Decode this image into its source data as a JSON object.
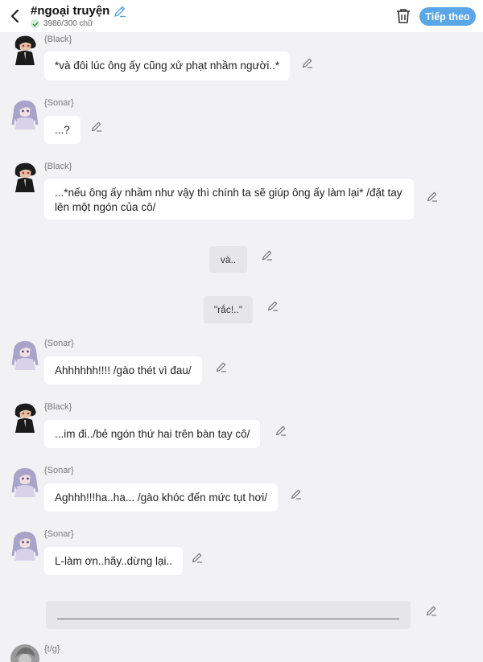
{
  "header": {
    "title": "#ngoại truyện",
    "word_count": "3986/300 chữ",
    "next_label": "Tiếp theo",
    "accent_color": "#5aa6e6"
  },
  "messages": [
    {
      "speaker": "{Black}",
      "text": "*và đôi lúc ông ấy cũng xử phạt nhầm người..*",
      "avatar": "black-character"
    },
    {
      "speaker": "{Sonar}",
      "text": "...?",
      "avatar": "sonar-character"
    },
    {
      "speaker": "{Black}",
      "text": "...*nếu ông ấy nhầm như vậy thì chính ta sẽ giúp ông ấy làm lại* /đặt tay lên một ngón của cô/",
      "avatar": "black-character"
    },
    {
      "narration": "và.."
    },
    {
      "narration": "\"rắc!..\""
    },
    {
      "speaker": "{Sonar}",
      "text": "Ahhhhhh!!!! /gào thét vì đau/",
      "avatar": "sonar-character"
    },
    {
      "speaker": "{Black}",
      "text": "...im đi../bẻ ngón thứ hai trên bàn tay cô/",
      "avatar": "black-character"
    },
    {
      "speaker": "{Sonar}",
      "text": "Aghhh!!!ha..ha... /gào khóc đến mức tụt hơi/",
      "avatar": "sonar-character"
    },
    {
      "speaker": "{Sonar}",
      "text": "L-làm ơn..hãy..dừng lại..",
      "avatar": "sonar-character"
    },
    {
      "speaker": "{t/g}",
      "avatar": "author-character"
    }
  ],
  "composer": {
    "value": ""
  }
}
